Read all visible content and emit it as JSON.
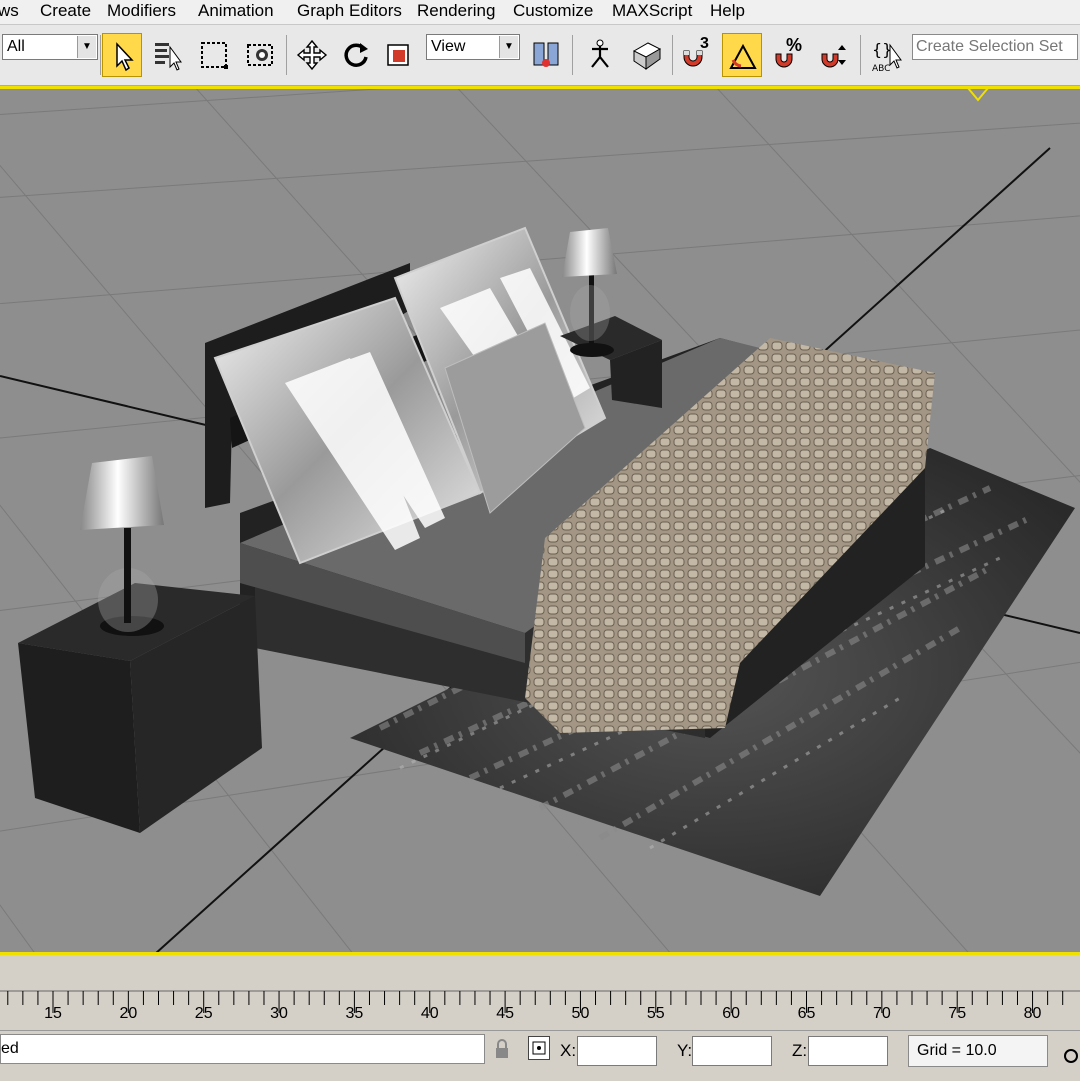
{
  "menu": {
    "items": [
      "ws",
      "Create",
      "Modifiers",
      "Animation",
      "Graph Editors",
      "Rendering",
      "Customize",
      "MAXScript",
      "Help"
    ]
  },
  "toolbar": {
    "filter_value": "All",
    "coord_system_value": "View",
    "snap_toggle_label": "3",
    "percent_snap_label": "%",
    "selection_set_placeholder": "Create Selection Set"
  },
  "timeline": {
    "ticks": [
      "15",
      "20",
      "25",
      "30",
      "35",
      "40",
      "45",
      "50",
      "55",
      "60",
      "65",
      "70",
      "75",
      "80"
    ]
  },
  "status": {
    "prompt_text": "ed",
    "x_label": "X:",
    "y_label": "Y:",
    "z_label": "Z:",
    "x_value": "",
    "y_value": "",
    "z_value": "",
    "grid_text": "Grid = 10.0"
  },
  "colors": {
    "active_viewport_border": "#f0e000",
    "active_button": "#ffd94a",
    "viewport_bg": "#8e8e8e"
  }
}
